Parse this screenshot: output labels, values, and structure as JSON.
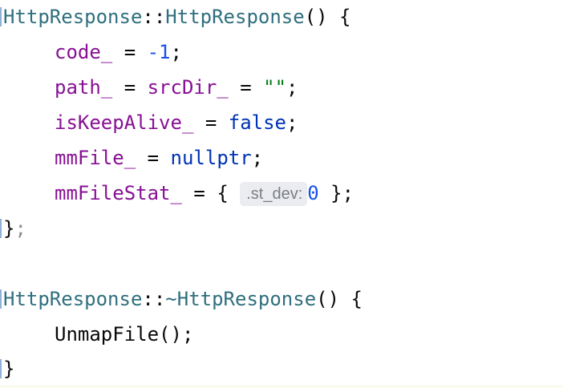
{
  "code": {
    "line1": {
      "class_name": "HttpResponse",
      "scope": "::",
      "ctor_name": "HttpResponse",
      "parens": "()",
      "brace": " {"
    },
    "line2": {
      "field": "code_",
      "assign": " = ",
      "value": "-1",
      "end": ";"
    },
    "line3": {
      "field": "path_",
      "assign1": " = ",
      "field2": "srcDir_",
      "assign2": " = ",
      "value": "\"\"",
      "end": ";"
    },
    "line4": {
      "field": "isKeepAlive_",
      "assign": " = ",
      "value": "false",
      "end": ";"
    },
    "line5": {
      "field": "mmFile_",
      "assign": " = ",
      "value": "nullptr",
      "end": ";"
    },
    "line6": {
      "field": "mmFileStat_",
      "assign": " = ",
      "open": "{ ",
      "hint": ".st_dev:",
      "value": "0",
      "close": " };"
    },
    "line7": {
      "close": "}",
      "end": ";"
    },
    "line9": {
      "class_name": "HttpResponse",
      "scope": "::",
      "dtor_name": "~HttpResponse",
      "parens": "()",
      "brace": " {"
    },
    "line10": {
      "call": "UnmapFile",
      "parens": "()",
      "end": ";"
    },
    "line11": {
      "close": "}"
    }
  },
  "colors": {
    "class": "#2f6f7e",
    "field": "#871094",
    "number": "#1750eb",
    "keyword": "#0033b3",
    "string": "#067d17",
    "text": "#080808"
  }
}
